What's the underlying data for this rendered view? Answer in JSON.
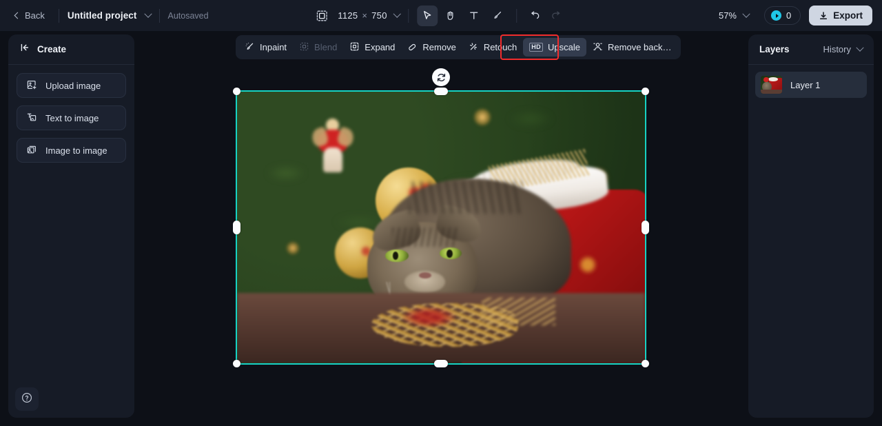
{
  "topbar": {
    "back_label": "Back",
    "project_name": "Untitled project",
    "autosave_label": "Autosaved",
    "canvas_size_icon": "canvas-size-icon",
    "dimensions": {
      "width": "1125",
      "separator": "×",
      "height": "750"
    },
    "tools": [
      {
        "name": "select-tool",
        "icon": "cursor-arrow-icon",
        "active": true
      },
      {
        "name": "hand-tool",
        "icon": "hand-icon",
        "active": false
      },
      {
        "name": "text-tool",
        "icon": "text-t-icon",
        "active": false
      },
      {
        "name": "brush-tool",
        "icon": "brush-icon",
        "active": false
      }
    ],
    "undo_icon": "undo-arrow-icon",
    "redo_icon": "redo-arrow-icon",
    "zoom_level": "57%",
    "credits_count": "0",
    "export_label": "Export"
  },
  "sidebar": {
    "title": "Create",
    "collapse_icon": "collapse-panel-icon",
    "items": [
      {
        "label": "Upload image",
        "icon": "upload-image-icon"
      },
      {
        "label": "Text to image",
        "icon": "text-to-image-icon"
      },
      {
        "label": "Image to image",
        "icon": "image-to-image-icon"
      }
    ],
    "help_icon": "help-circle-icon"
  },
  "edit_toolbar": {
    "items": [
      {
        "label": "Inpaint",
        "icon": "inpaint-icon",
        "state": "normal"
      },
      {
        "label": "Blend",
        "icon": "blend-icon",
        "state": "disabled"
      },
      {
        "label": "Expand",
        "icon": "expand-icon",
        "state": "normal"
      },
      {
        "label": "Remove",
        "icon": "eraser-icon",
        "state": "normal"
      },
      {
        "label": "Retouch",
        "icon": "retouch-wand-icon",
        "state": "normal"
      },
      {
        "label": "Upscale",
        "icon": "hd-badge-icon",
        "state": "selected",
        "badge": "HD"
      },
      {
        "label": "Remove back…",
        "icon": "remove-background-icon",
        "state": "normal"
      }
    ],
    "highlight_color": "#f22c2c",
    "highlighted_item": "Upscale"
  },
  "canvas": {
    "selection_color": "#16d3c4",
    "rotate_handle_icon": "rotate-icon",
    "image_alt": "Tabby cat beside a red Santa sack in front of a Christmas tree"
  },
  "right_panel": {
    "title": "Layers",
    "history_label": "History",
    "history_caret_icon": "chevron-down-icon",
    "layers": [
      {
        "name": "Layer 1",
        "thumb": "layer-thumbnail"
      }
    ]
  }
}
